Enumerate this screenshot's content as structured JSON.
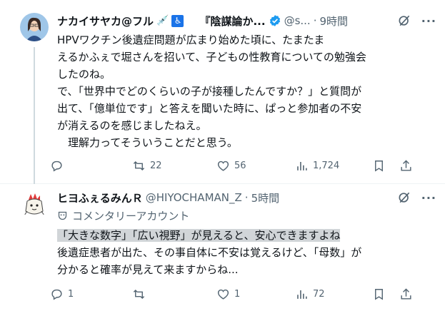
{
  "tweet1": {
    "author_name": "ナカイサヤカ@フル",
    "author_emoji": "💉",
    "wheelchair": "♿",
    "quoted_title": "『陰謀論か...",
    "handle": "@s...",
    "time": "9時間",
    "body_lines": [
      "HPVワクチン後遺症問題が広まり始めた頃に、たまたま",
      "えるかふぇで堀さんを招いて、子どもの性教育についての勉強会",
      "したのね。",
      "で、「世界中でどのくらいの子が接種したんですか？」と質問が",
      "出て、「億単位です」と答えを聞いた時に、ぱっと参加者の不安",
      "が消えるのを感じましたねえ。",
      "　理解力ってそういうことだと思う。"
    ],
    "replies": "",
    "retweets": "22",
    "likes": "56",
    "views": "1,724"
  },
  "tweet2": {
    "author_name": "ヒヨふぇるみんＲ",
    "handle": "@HIYOCHAMAN_Z",
    "time": "5時間",
    "community_label": "コメンタリーアカウント",
    "highlighted_line": "「大きな数字」「広い視野」が見えると、安心できますよね",
    "body_lines": [
      "後遺症患者が出た、その事自体に不安は覚えるけど、「母数」が",
      "分かると確率が見えて来ますからね..."
    ],
    "replies": "1",
    "retweets": "",
    "likes": "1",
    "views": "72"
  },
  "colors": {
    "text": "#0f1419",
    "muted": "#536471",
    "verified": "#1d9bf0",
    "highlight": "#d1d5d8"
  }
}
